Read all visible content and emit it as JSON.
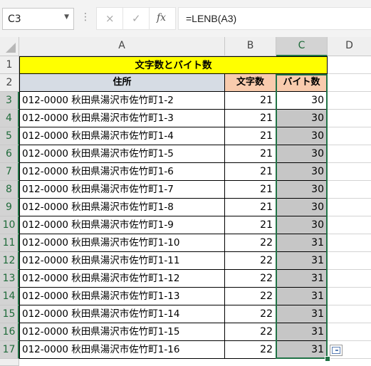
{
  "formula_bar": {
    "name_box": "C3",
    "cancel_icon": "×",
    "enter_icon": "✓",
    "fx_label": "fx",
    "formula": "=LENB(A3)"
  },
  "columns": [
    "A",
    "B",
    "C",
    "D"
  ],
  "table": {
    "title": "文字数とバイト数",
    "headers": [
      "住所",
      "文字数",
      "バイト数"
    ],
    "rows": [
      {
        "row": "3",
        "address": "012-0000 秋田県湯沢市佐竹町1-2",
        "chars": "21",
        "bytes": "30"
      },
      {
        "row": "4",
        "address": "012-0000 秋田県湯沢市佐竹町1-3",
        "chars": "21",
        "bytes": "30"
      },
      {
        "row": "5",
        "address": "012-0000 秋田県湯沢市佐竹町1-4",
        "chars": "21",
        "bytes": "30"
      },
      {
        "row": "6",
        "address": "012-0000 秋田県湯沢市佐竹町1-5",
        "chars": "21",
        "bytes": "30"
      },
      {
        "row": "7",
        "address": "012-0000 秋田県湯沢市佐竹町1-6",
        "chars": "21",
        "bytes": "30"
      },
      {
        "row": "8",
        "address": "012-0000 秋田県湯沢市佐竹町1-7",
        "chars": "21",
        "bytes": "30"
      },
      {
        "row": "9",
        "address": "012-0000 秋田県湯沢市佐竹町1-8",
        "chars": "21",
        "bytes": "30"
      },
      {
        "row": "10",
        "address": "012-0000 秋田県湯沢市佐竹町1-9",
        "chars": "21",
        "bytes": "30"
      },
      {
        "row": "11",
        "address": "012-0000 秋田県湯沢市佐竹町1-10",
        "chars": "22",
        "bytes": "31"
      },
      {
        "row": "12",
        "address": "012-0000 秋田県湯沢市佐竹町1-11",
        "chars": "22",
        "bytes": "31"
      },
      {
        "row": "13",
        "address": "012-0000 秋田県湯沢市佐竹町1-12",
        "chars": "22",
        "bytes": "31"
      },
      {
        "row": "14",
        "address": "012-0000 秋田県湯沢市佐竹町1-13",
        "chars": "22",
        "bytes": "31"
      },
      {
        "row": "15",
        "address": "012-0000 秋田県湯沢市佐竹町1-14",
        "chars": "22",
        "bytes": "31"
      },
      {
        "row": "16",
        "address": "012-0000 秋田県湯沢市佐竹町1-15",
        "chars": "22",
        "bytes": "31"
      },
      {
        "row": "17",
        "address": "012-0000 秋田県湯沢市佐竹町1-16",
        "chars": "22",
        "bytes": "31"
      }
    ]
  },
  "colors": {
    "title_fill": "#ffff00",
    "header_address_fill": "#d6dce4",
    "header_chars_fill": "#f8cbad",
    "selection_border": "#217346",
    "selection_fill": "#c6c6c6"
  }
}
